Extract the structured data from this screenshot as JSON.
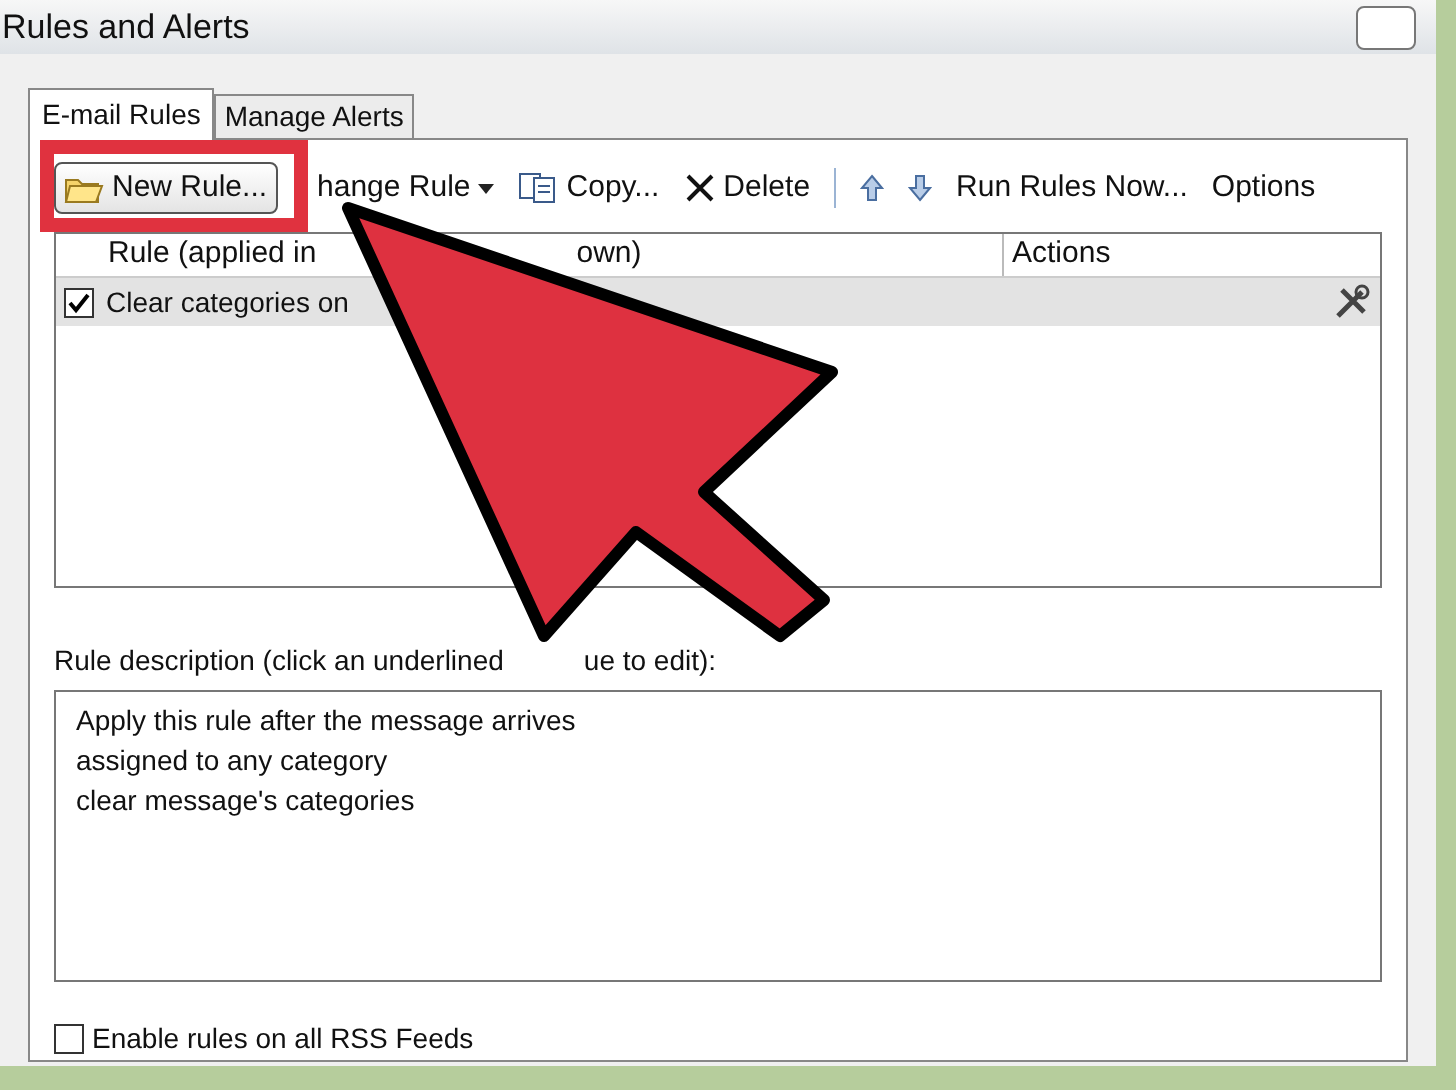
{
  "window": {
    "title": "Rules and Alerts"
  },
  "tabs": [
    {
      "label": "E-mail Rules",
      "selected": true
    },
    {
      "label": "Manage Alerts",
      "selected": false
    }
  ],
  "toolbar": [
    {
      "kind": "new",
      "label": "New Rule..."
    },
    {
      "kind": "dropdown",
      "label": "hange Rule"
    },
    {
      "kind": "copy",
      "label": "Copy..."
    },
    {
      "kind": "delete",
      "label": "Delete"
    },
    {
      "kind": "separator"
    },
    {
      "kind": "up"
    },
    {
      "kind": "down"
    },
    {
      "kind": "plain",
      "label": "Run Rules Now..."
    },
    {
      "kind": "plain",
      "label": "Options"
    }
  ],
  "rules_table": {
    "columns": [
      {
        "parts": [
          "Rule (applied in",
          "own)"
        ]
      },
      {
        "parts": [
          "Actions"
        ]
      }
    ],
    "rows": [
      {
        "name": "Clear categories on",
        "checked": true,
        "selected": true
      }
    ]
  },
  "description": {
    "label_parts": [
      "Rule description (click an underlined",
      "ue to edit):"
    ],
    "lines": [
      "Apply this rule after the message arrives",
      "assigned to any category",
      "clear message's categories"
    ]
  },
  "rss": {
    "label": "Enable rules on all RSS Feeds",
    "checked": false
  }
}
